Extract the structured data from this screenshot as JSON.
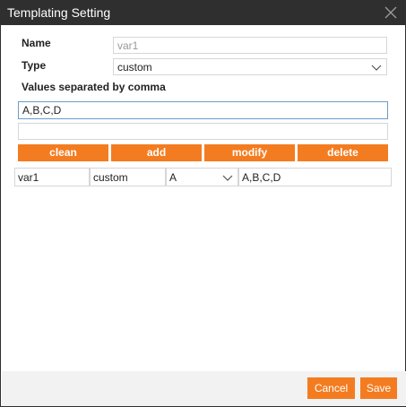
{
  "dialog": {
    "title": "Templating Setting",
    "close_icon": "close-icon"
  },
  "form": {
    "name_label": "Name",
    "name_value": "var1",
    "type_label": "Type",
    "type_value": "custom",
    "values_label": "Values separated by comma",
    "values_value": "A,B,C,D",
    "extra_value": ""
  },
  "actions": {
    "clean": "clean",
    "add": "add",
    "modify": "modify",
    "delete": "delete"
  },
  "table": {
    "rows": [
      {
        "name": "var1",
        "type": "custom",
        "current": "A",
        "values": "A,B,C,D"
      }
    ]
  },
  "footer": {
    "cancel": "Cancel",
    "save": "Save"
  },
  "colors": {
    "accent": "#f47c20",
    "titlebar": "#2f2f2f",
    "footer_bg": "#f2f2f2"
  }
}
